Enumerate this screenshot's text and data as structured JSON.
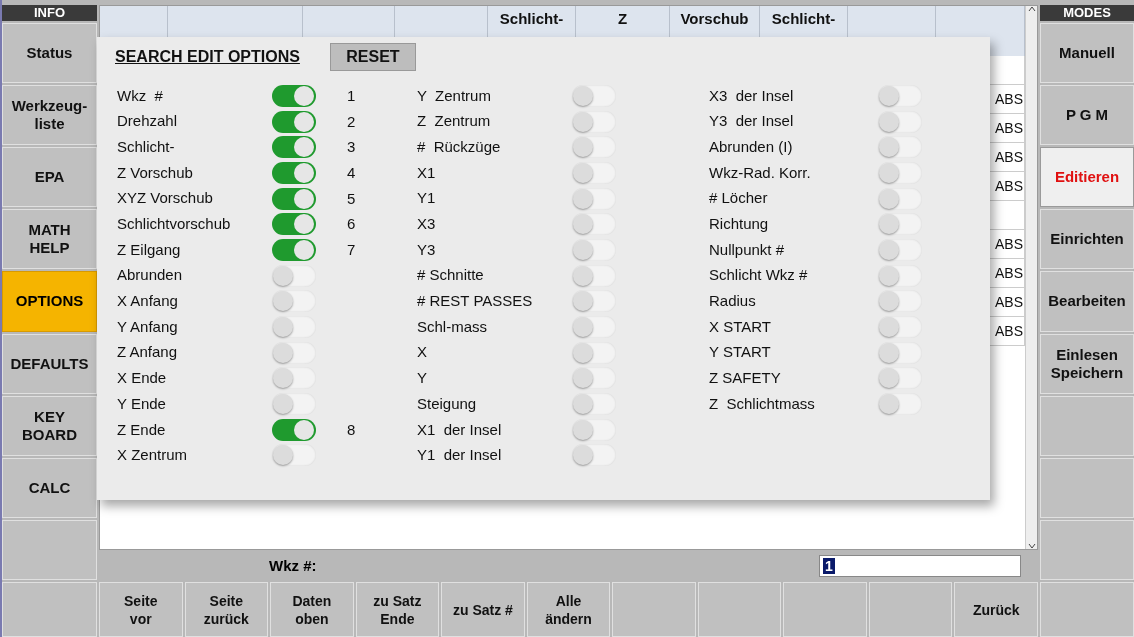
{
  "info_panel": {
    "title": "INFO",
    "items": [
      {
        "kind": "key",
        "label": "Status",
        "selected": false
      },
      {
        "kind": "key",
        "label": "Werkzeug-\nliste",
        "selected": false
      },
      {
        "kind": "key",
        "label": "EPA",
        "selected": false
      },
      {
        "kind": "key",
        "label": "MATH\nHELP",
        "selected": false
      },
      {
        "kind": "key",
        "label": "OPTIONS",
        "selected": true
      },
      {
        "kind": "key",
        "label": "DEFAULTS",
        "selected": false
      },
      {
        "kind": "key",
        "label": "KEY\nBOARD",
        "selected": false
      },
      {
        "kind": "key",
        "label": "CALC",
        "selected": false
      },
      {
        "kind": "blank"
      }
    ]
  },
  "modes_panel": {
    "title": "MODES",
    "items": [
      {
        "kind": "key",
        "label": "Manuell",
        "selected": false
      },
      {
        "kind": "key",
        "label": "P G M",
        "selected": false
      },
      {
        "kind": "key",
        "label": "Editieren",
        "selected": true
      },
      {
        "kind": "key",
        "label": "Einrichten",
        "selected": false
      },
      {
        "kind": "key",
        "label": "Bearbeiten",
        "selected": false
      },
      {
        "kind": "key",
        "label": "Einlesen\nSpeichern",
        "selected": false
      },
      {
        "kind": "blank"
      },
      {
        "kind": "blank"
      },
      {
        "kind": "blank"
      }
    ]
  },
  "table": {
    "columns": [
      {
        "kind": "covered"
      },
      {
        "kind": "covered"
      },
      {
        "kind": "covered"
      },
      {
        "kind": "covered"
      },
      {
        "kind": "label",
        "label": "Schlicht-"
      },
      {
        "kind": "label",
        "label": "Z"
      },
      {
        "kind": "label",
        "label": "Vorschub"
      },
      {
        "kind": "label",
        "label": "Schlicht-"
      },
      {
        "kind": "covered"
      },
      {
        "kind": "covered"
      }
    ],
    "rows": [
      {},
      {
        "column_10": "ABS"
      },
      {
        "column_10": "ABS"
      },
      {
        "column_10": "ABS"
      },
      {
        "column_10": "ABS"
      },
      {},
      {
        "column_10": "ABS"
      },
      {
        "column_10": "ABS"
      },
      {
        "column_10": "ABS"
      },
      {
        "column_10": "ABS"
      }
    ]
  },
  "dialog": {
    "title": "SEARCH EDIT OPTIONS",
    "reset_button": "RESET",
    "columns": [
      [
        {
          "label": "Wkz  #",
          "on": true,
          "order": "1"
        },
        {
          "label": "Drehzahl",
          "on": true,
          "order": "2"
        },
        {
          "label": "Schlicht-",
          "on": true,
          "order": "3"
        },
        {
          "label": "Z Vorschub",
          "on": true,
          "order": "4"
        },
        {
          "label": "XYZ Vorschub",
          "on": true,
          "order": "5"
        },
        {
          "label": "Schlichtvorschub",
          "on": true,
          "order": "6"
        },
        {
          "label": "Z Eilgang",
          "on": true,
          "order": "7"
        },
        {
          "label": "Abrunden",
          "on": false
        },
        {
          "label": "X Anfang",
          "on": false
        },
        {
          "label": "Y Anfang",
          "on": false
        },
        {
          "label": "Z Anfang",
          "on": false
        },
        {
          "label": "X Ende",
          "on": false
        },
        {
          "label": "Y Ende",
          "on": false
        },
        {
          "label": "Z Ende",
          "on": true,
          "order": "8"
        },
        {
          "label": "X Zentrum",
          "on": false
        }
      ],
      [
        {
          "label": "Y  Zentrum",
          "on": false
        },
        {
          "label": "Z  Zentrum",
          "on": false
        },
        {
          "label": "#  Rückzüge",
          "on": false
        },
        {
          "label": "X1",
          "on": false
        },
        {
          "label": "Y1",
          "on": false
        },
        {
          "label": "X3",
          "on": false
        },
        {
          "label": "Y3",
          "on": false
        },
        {
          "label": "# Schnitte",
          "on": false
        },
        {
          "label": "# REST PASSES",
          "on": false
        },
        {
          "label": "Schl-mass",
          "on": false
        },
        {
          "label": "X",
          "on": false
        },
        {
          "label": "Y",
          "on": false
        },
        {
          "label": "Steigung",
          "on": false
        },
        {
          "label": "X1  der Insel",
          "on": false
        },
        {
          "label": "Y1  der Insel",
          "on": false
        }
      ],
      [
        {
          "label": "X3  der Insel",
          "on": false
        },
        {
          "label": "Y3  der Insel",
          "on": false
        },
        {
          "label": "Abrunden (I)",
          "on": false
        },
        {
          "label": "Wkz-Rad. Korr.",
          "on": false
        },
        {
          "label": "# Löcher",
          "on": false
        },
        {
          "label": "Richtung",
          "on": false
        },
        {
          "label": "Nullpunkt #",
          "on": false
        },
        {
          "label": "Schlicht Wkz #",
          "on": false
        },
        {
          "label": "Radius",
          "on": false
        },
        {
          "label": "X START",
          "on": false
        },
        {
          "label": "Y START",
          "on": false
        },
        {
          "label": "Z SAFETY",
          "on": false
        },
        {
          "label": "Z  Schlichtmass",
          "on": false
        }
      ]
    ]
  },
  "input": {
    "label": "Wkz #:",
    "value": "1"
  },
  "softkeys": [
    {
      "kind": "blank"
    },
    {
      "kind": "key",
      "label": "Seite\nvor"
    },
    {
      "kind": "key",
      "label": "Seite\nzurück"
    },
    {
      "kind": "key",
      "label": "Daten\noben"
    },
    {
      "kind": "key",
      "label": "zu Satz\nEnde"
    },
    {
      "kind": "key",
      "label": "zu Satz  #"
    },
    {
      "kind": "key",
      "label": "Alle\nändern"
    },
    {
      "kind": "blank"
    },
    {
      "kind": "blank"
    },
    {
      "kind": "blank"
    },
    {
      "kind": "blank"
    },
    {
      "kind": "key",
      "label": "Zurück"
    },
    {
      "kind": "blank"
    }
  ]
}
